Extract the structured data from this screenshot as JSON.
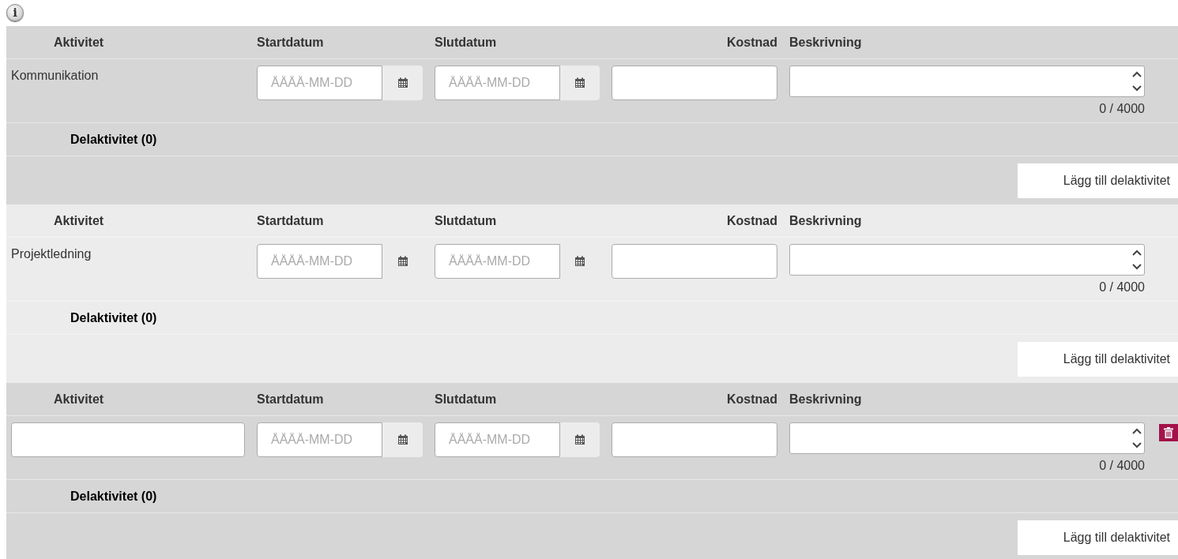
{
  "info_icon_label": "i",
  "activities": [
    {
      "kind": "fixed",
      "name": "Kommunikation",
      "headers": {
        "activity": "Aktivitet",
        "start": "Startdatum",
        "end": "Slutdatum",
        "cost": "Kostnad",
        "description": "Beskrivning"
      },
      "start_placeholder": "ÅÅÅÅ-MM-DD",
      "end_placeholder": "ÅÅÅÅ-MM-DD",
      "char_count": "0 / 4000",
      "subactivities": "Delaktivitet (0)",
      "add_button": "Lägg till delaktivitet",
      "deletable": false
    },
    {
      "kind": "fixed",
      "name": "Projektledning",
      "headers": {
        "activity": "Aktivitet",
        "start": "Startdatum",
        "end": "Slutdatum",
        "cost": "Kostnad",
        "description": "Beskrivning"
      },
      "start_placeholder": "ÅÅÅÅ-MM-DD",
      "end_placeholder": "ÅÅÅÅ-MM-DD",
      "char_count": "0 / 4000",
      "subactivities": "Delaktivitet (0)",
      "add_button": "Lägg till delaktivitet",
      "deletable": false
    },
    {
      "kind": "editable",
      "headers": {
        "activity": "Aktivitet",
        "start": "Startdatum",
        "end": "Slutdatum",
        "cost": "Kostnad",
        "description": "Beskrivning"
      },
      "start_placeholder": "ÅÅÅÅ-MM-DD",
      "end_placeholder": "ÅÅÅÅ-MM-DD",
      "char_count": "0 / 4000",
      "subactivities": "Delaktivitet (0)",
      "add_button": "Lägg till delaktivitet",
      "deletable": true
    }
  ]
}
